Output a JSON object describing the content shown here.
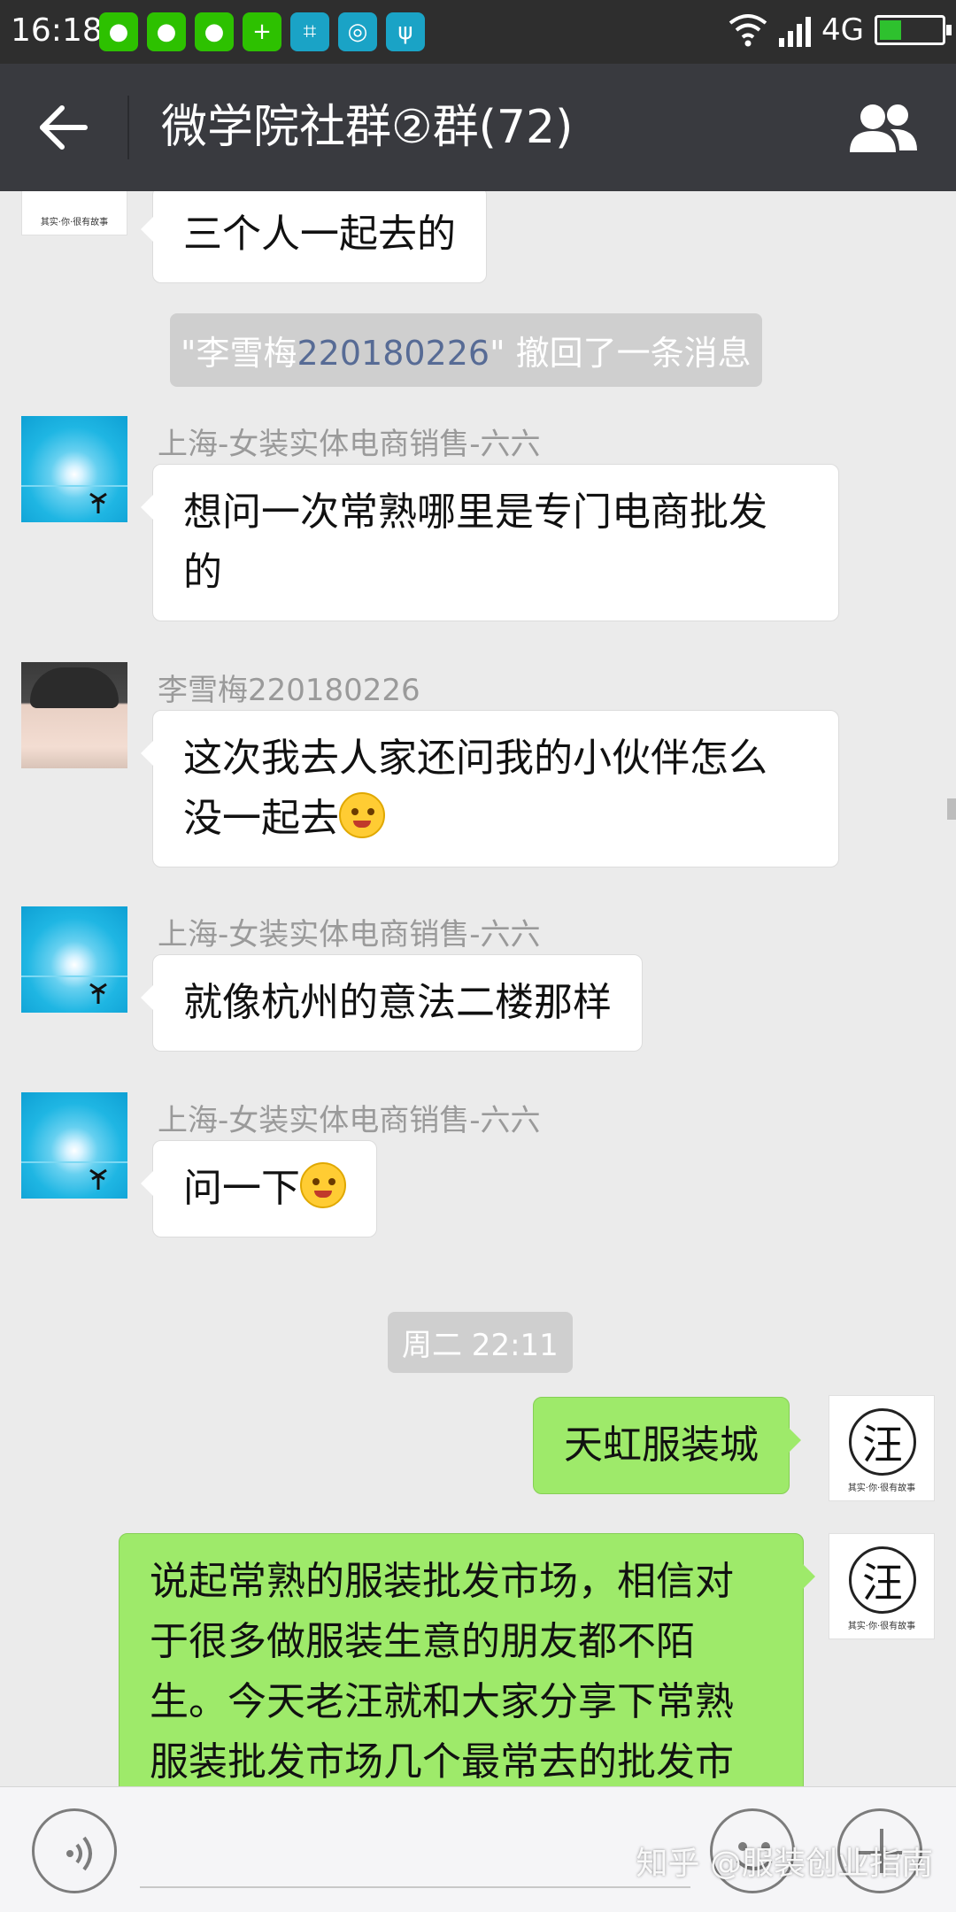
{
  "status_bar": {
    "time": "16:18",
    "network": "4G",
    "notification_icons": [
      "wechat-icon",
      "wechat-icon",
      "wechat-icon",
      "plus-app-icon",
      "scan-icon",
      "basketball-app-icon",
      "usb-icon"
    ]
  },
  "header": {
    "title": "微学院社群②群(72)"
  },
  "messages": {
    "m0": {
      "text": "三个人一起去的"
    },
    "recall": {
      "prefix": "\"李雪梅",
      "name_num": "220180226",
      "suffix": "\" 撤回了一条消息"
    },
    "m1": {
      "sender": "上海-女装实体电商销售-六六",
      "line1": "想问一次常熟哪里是专门电商批发",
      "line2": "的"
    },
    "m2": {
      "sender": "李雪梅220180226",
      "line1": "这次我去人家还问我的小伙伴怎么",
      "line2": "没一起去"
    },
    "m3": {
      "sender": "上海-女装实体电商销售-六六",
      "text": "就像杭州的意法二楼那样"
    },
    "m4": {
      "sender": "上海-女装实体电商销售-六六",
      "text": "问一下"
    },
    "time_sep": "周二 22:11",
    "m5": {
      "text": "天虹服装城"
    },
    "m6": {
      "line1": "说起常熟的服装批发市场，相信对",
      "line2": "于很多做服装生意的朋友都不陌",
      "line3": "生。今天老汪就和大家分享下常熟",
      "line4": "服装批发市场几个最常去的批发市"
    },
    "wang_avatar": {
      "glyph": "汪",
      "caption": "其实·你·很有故事"
    }
  },
  "watermark": "知乎 @服装创业指南",
  "colors": {
    "header_bg": "#393a3f",
    "out_bubble": "#9eea6a",
    "in_bubble": "#ffffff",
    "chat_bg": "#ebebeb",
    "link_blue": "#576b95"
  }
}
